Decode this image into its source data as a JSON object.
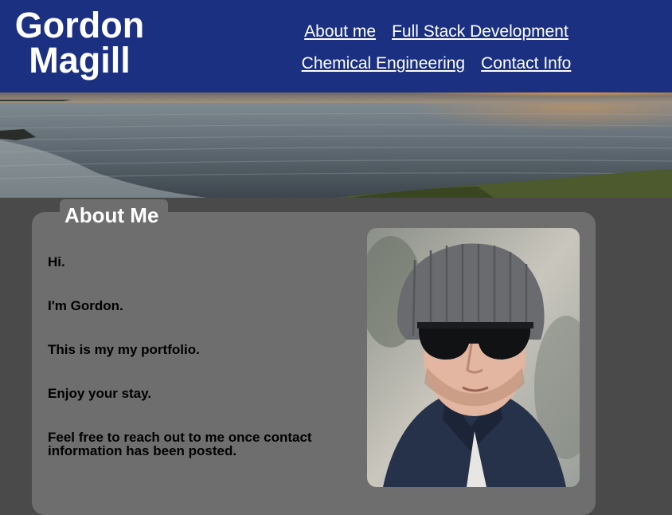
{
  "header": {
    "site_name_line1": "Gordon",
    "site_name_line2": "Magill",
    "nav": [
      {
        "label": "About me"
      },
      {
        "label": "Full Stack Development"
      },
      {
        "label": "Chemical Engineering"
      },
      {
        "label": "Contact Info"
      }
    ]
  },
  "about": {
    "title": "About Me",
    "paragraphs": [
      "Hi.",
      "I'm Gordon.",
      "This is my my portfolio.",
      "Enjoy your stay.",
      "Feel free to reach out to me once contact information has been posted."
    ]
  },
  "colors": {
    "header_bg": "#1b3081",
    "page_bg": "#4a4a4a",
    "card_bg": "#6e6e6e"
  }
}
